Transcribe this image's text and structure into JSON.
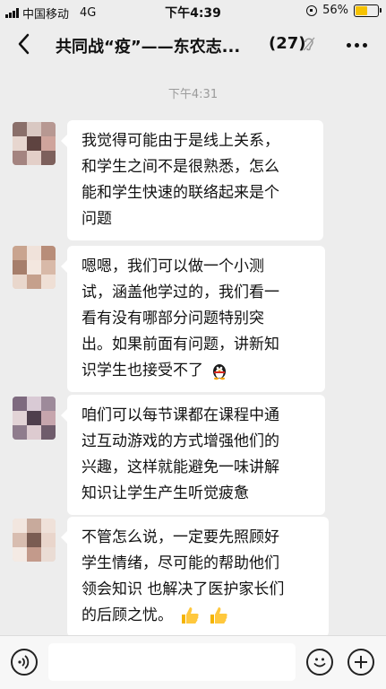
{
  "status_bar": {
    "carrier": "中国移动",
    "network": "4G",
    "time": "下午4:39",
    "battery_percent": "56%",
    "battery_level": 0.56,
    "battery_color": "#f5c200"
  },
  "nav": {
    "title": "共同战“疫”——东农志...",
    "member_count": "(27)",
    "back_icon": "chevron-left-icon",
    "mute_icon": "ear-mute-icon",
    "more_icon": "more-dots-icon"
  },
  "chat": {
    "timestamp": "下午4:31",
    "messages": [
      {
        "lines": [
          "我觉得可能由于是线上关系，",
          "和学生之间不是很熟悉，怎么",
          "能和学生快速的联络起来是个",
          "问题"
        ]
      },
      {
        "lines": [
          "嗯嗯，我们可以做一个小测",
          "试，涵盖他学过的，我们看一",
          "看有没有哪部分问题特别突",
          "出。如果前面有问题，讲新知",
          "识学生也接受不了"
        ],
        "trailing_emoji": "penguin-emoji"
      },
      {
        "lines": [
          "咱们可以每节课都在课程中通",
          "过互动游戏的方式增强他们的",
          "兴趣，这样就能避免一味讲解",
          "知识让学生产生听觉疲惫"
        ]
      },
      {
        "lines": [
          "不管怎么说，一定要先照顾好",
          "学生情绪，尽可能的帮助他们",
          "领会知识 也解决了医护家长们",
          "的后顾之忧。"
        ],
        "trailing_emoji": "thumbs-up-emoji"
      }
    ]
  },
  "input_bar": {
    "voice_icon": "voice-icon",
    "input_value": "",
    "emoji_icon": "smiley-icon",
    "plus_icon": "plus-icon"
  }
}
